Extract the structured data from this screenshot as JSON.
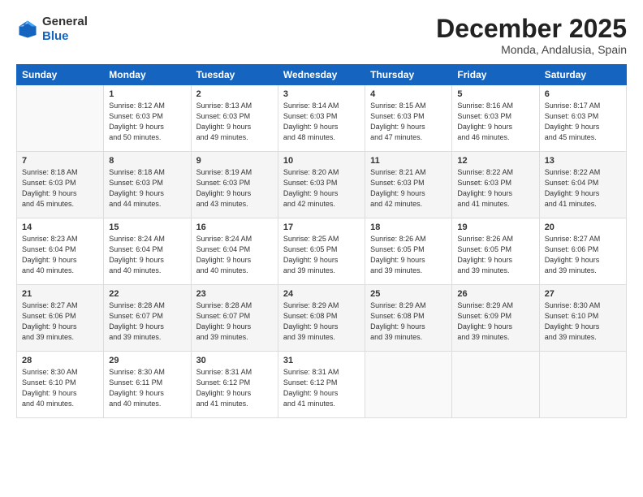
{
  "header": {
    "logo_line1": "General",
    "logo_line2": "Blue",
    "month": "December 2025",
    "location": "Monda, Andalusia, Spain"
  },
  "days_of_week": [
    "Sunday",
    "Monday",
    "Tuesday",
    "Wednesday",
    "Thursday",
    "Friday",
    "Saturday"
  ],
  "weeks": [
    [
      {
        "day": "",
        "info": ""
      },
      {
        "day": "1",
        "info": "Sunrise: 8:12 AM\nSunset: 6:03 PM\nDaylight: 9 hours\nand 50 minutes."
      },
      {
        "day": "2",
        "info": "Sunrise: 8:13 AM\nSunset: 6:03 PM\nDaylight: 9 hours\nand 49 minutes."
      },
      {
        "day": "3",
        "info": "Sunrise: 8:14 AM\nSunset: 6:03 PM\nDaylight: 9 hours\nand 48 minutes."
      },
      {
        "day": "4",
        "info": "Sunrise: 8:15 AM\nSunset: 6:03 PM\nDaylight: 9 hours\nand 47 minutes."
      },
      {
        "day": "5",
        "info": "Sunrise: 8:16 AM\nSunset: 6:03 PM\nDaylight: 9 hours\nand 46 minutes."
      },
      {
        "day": "6",
        "info": "Sunrise: 8:17 AM\nSunset: 6:03 PM\nDaylight: 9 hours\nand 45 minutes."
      }
    ],
    [
      {
        "day": "7",
        "info": "Sunrise: 8:18 AM\nSunset: 6:03 PM\nDaylight: 9 hours\nand 45 minutes."
      },
      {
        "day": "8",
        "info": "Sunrise: 8:18 AM\nSunset: 6:03 PM\nDaylight: 9 hours\nand 44 minutes."
      },
      {
        "day": "9",
        "info": "Sunrise: 8:19 AM\nSunset: 6:03 PM\nDaylight: 9 hours\nand 43 minutes."
      },
      {
        "day": "10",
        "info": "Sunrise: 8:20 AM\nSunset: 6:03 PM\nDaylight: 9 hours\nand 42 minutes."
      },
      {
        "day": "11",
        "info": "Sunrise: 8:21 AM\nSunset: 6:03 PM\nDaylight: 9 hours\nand 42 minutes."
      },
      {
        "day": "12",
        "info": "Sunrise: 8:22 AM\nSunset: 6:03 PM\nDaylight: 9 hours\nand 41 minutes."
      },
      {
        "day": "13",
        "info": "Sunrise: 8:22 AM\nSunset: 6:04 PM\nDaylight: 9 hours\nand 41 minutes."
      }
    ],
    [
      {
        "day": "14",
        "info": "Sunrise: 8:23 AM\nSunset: 6:04 PM\nDaylight: 9 hours\nand 40 minutes."
      },
      {
        "day": "15",
        "info": "Sunrise: 8:24 AM\nSunset: 6:04 PM\nDaylight: 9 hours\nand 40 minutes."
      },
      {
        "day": "16",
        "info": "Sunrise: 8:24 AM\nSunset: 6:04 PM\nDaylight: 9 hours\nand 40 minutes."
      },
      {
        "day": "17",
        "info": "Sunrise: 8:25 AM\nSunset: 6:05 PM\nDaylight: 9 hours\nand 39 minutes."
      },
      {
        "day": "18",
        "info": "Sunrise: 8:26 AM\nSunset: 6:05 PM\nDaylight: 9 hours\nand 39 minutes."
      },
      {
        "day": "19",
        "info": "Sunrise: 8:26 AM\nSunset: 6:05 PM\nDaylight: 9 hours\nand 39 minutes."
      },
      {
        "day": "20",
        "info": "Sunrise: 8:27 AM\nSunset: 6:06 PM\nDaylight: 9 hours\nand 39 minutes."
      }
    ],
    [
      {
        "day": "21",
        "info": "Sunrise: 8:27 AM\nSunset: 6:06 PM\nDaylight: 9 hours\nand 39 minutes."
      },
      {
        "day": "22",
        "info": "Sunrise: 8:28 AM\nSunset: 6:07 PM\nDaylight: 9 hours\nand 39 minutes."
      },
      {
        "day": "23",
        "info": "Sunrise: 8:28 AM\nSunset: 6:07 PM\nDaylight: 9 hours\nand 39 minutes."
      },
      {
        "day": "24",
        "info": "Sunrise: 8:29 AM\nSunset: 6:08 PM\nDaylight: 9 hours\nand 39 minutes."
      },
      {
        "day": "25",
        "info": "Sunrise: 8:29 AM\nSunset: 6:08 PM\nDaylight: 9 hours\nand 39 minutes."
      },
      {
        "day": "26",
        "info": "Sunrise: 8:29 AM\nSunset: 6:09 PM\nDaylight: 9 hours\nand 39 minutes."
      },
      {
        "day": "27",
        "info": "Sunrise: 8:30 AM\nSunset: 6:10 PM\nDaylight: 9 hours\nand 39 minutes."
      }
    ],
    [
      {
        "day": "28",
        "info": "Sunrise: 8:30 AM\nSunset: 6:10 PM\nDaylight: 9 hours\nand 40 minutes."
      },
      {
        "day": "29",
        "info": "Sunrise: 8:30 AM\nSunset: 6:11 PM\nDaylight: 9 hours\nand 40 minutes."
      },
      {
        "day": "30",
        "info": "Sunrise: 8:31 AM\nSunset: 6:12 PM\nDaylight: 9 hours\nand 41 minutes."
      },
      {
        "day": "31",
        "info": "Sunrise: 8:31 AM\nSunset: 6:12 PM\nDaylight: 9 hours\nand 41 minutes."
      },
      {
        "day": "",
        "info": ""
      },
      {
        "day": "",
        "info": ""
      },
      {
        "day": "",
        "info": ""
      }
    ]
  ]
}
